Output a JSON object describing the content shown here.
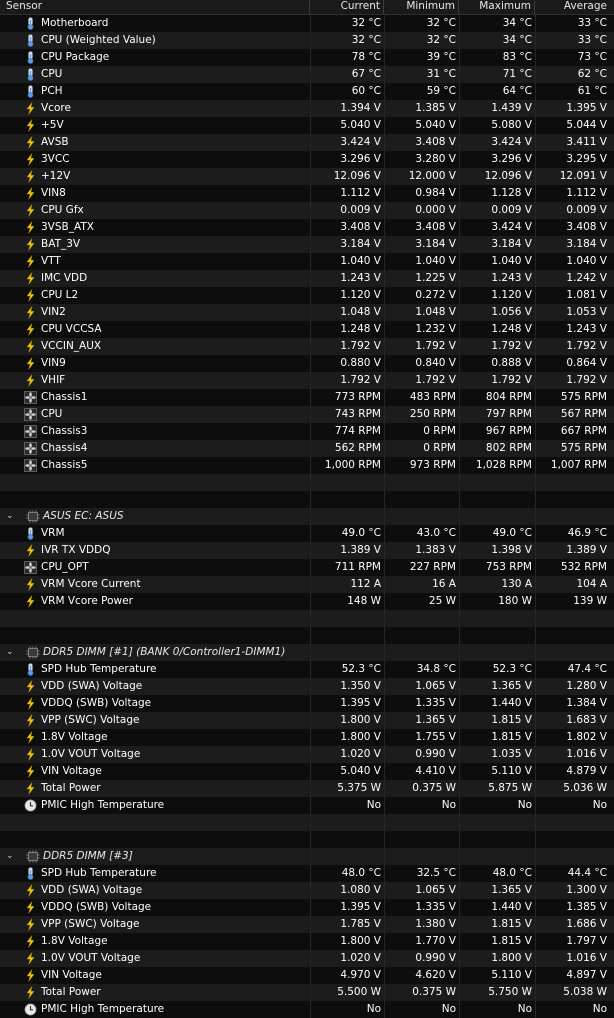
{
  "header": {
    "sensor": "Sensor",
    "current": "Current",
    "minimum": "Minimum",
    "maximum": "Maximum",
    "average": "Average"
  },
  "sections": [
    {
      "title": "",
      "rows": [
        {
          "icon": "thermometer-icon",
          "name": "Motherboard",
          "cur": "32 °C",
          "min": "32 °C",
          "max": "34 °C",
          "avg": "33 °C"
        },
        {
          "icon": "thermometer-icon",
          "name": "CPU (Weighted Value)",
          "cur": "32 °C",
          "min": "32 °C",
          "max": "34 °C",
          "avg": "33 °C"
        },
        {
          "icon": "thermometer-icon",
          "name": "CPU Package",
          "cur": "78 °C",
          "min": "39 °C",
          "max": "83 °C",
          "avg": "73 °C"
        },
        {
          "icon": "thermometer-icon",
          "name": "CPU",
          "cur": "67 °C",
          "min": "31 °C",
          "max": "71 °C",
          "avg": "62 °C"
        },
        {
          "icon": "thermometer-icon",
          "name": "PCH",
          "cur": "60 °C",
          "min": "59 °C",
          "max": "64 °C",
          "avg": "61 °C"
        },
        {
          "icon": "lightning-icon",
          "name": "Vcore",
          "cur": "1.394 V",
          "min": "1.385 V",
          "max": "1.439 V",
          "avg": "1.395 V"
        },
        {
          "icon": "lightning-icon",
          "name": "+5V",
          "cur": "5.040 V",
          "min": "5.040 V",
          "max": "5.080 V",
          "avg": "5.044 V"
        },
        {
          "icon": "lightning-icon",
          "name": "AVSB",
          "cur": "3.424 V",
          "min": "3.408 V",
          "max": "3.424 V",
          "avg": "3.411 V"
        },
        {
          "icon": "lightning-icon",
          "name": "3VCC",
          "cur": "3.296 V",
          "min": "3.280 V",
          "max": "3.296 V",
          "avg": "3.295 V"
        },
        {
          "icon": "lightning-icon",
          "name": "+12V",
          "cur": "12.096 V",
          "min": "12.000 V",
          "max": "12.096 V",
          "avg": "12.091 V"
        },
        {
          "icon": "lightning-icon",
          "name": "VIN8",
          "cur": "1.112 V",
          "min": "0.984 V",
          "max": "1.128 V",
          "avg": "1.112 V"
        },
        {
          "icon": "lightning-icon",
          "name": "CPU Gfx",
          "cur": "0.009 V",
          "min": "0.000 V",
          "max": "0.009 V",
          "avg": "0.009 V"
        },
        {
          "icon": "lightning-icon",
          "name": "3VSB_ATX",
          "cur": "3.408 V",
          "min": "3.408 V",
          "max": "3.424 V",
          "avg": "3.408 V"
        },
        {
          "icon": "lightning-icon",
          "name": "BAT_3V",
          "cur": "3.184 V",
          "min": "3.184 V",
          "max": "3.184 V",
          "avg": "3.184 V"
        },
        {
          "icon": "lightning-icon",
          "name": "VTT",
          "cur": "1.040 V",
          "min": "1.040 V",
          "max": "1.040 V",
          "avg": "1.040 V"
        },
        {
          "icon": "lightning-icon",
          "name": "IMC VDD",
          "cur": "1.243 V",
          "min": "1.225 V",
          "max": "1.243 V",
          "avg": "1.242 V"
        },
        {
          "icon": "lightning-icon",
          "name": "CPU L2",
          "cur": "1.120 V",
          "min": "0.272 V",
          "max": "1.120 V",
          "avg": "1.081 V"
        },
        {
          "icon": "lightning-icon",
          "name": "VIN2",
          "cur": "1.048 V",
          "min": "1.048 V",
          "max": "1.056 V",
          "avg": "1.053 V"
        },
        {
          "icon": "lightning-icon",
          "name": "CPU VCCSA",
          "cur": "1.248 V",
          "min": "1.232 V",
          "max": "1.248 V",
          "avg": "1.243 V"
        },
        {
          "icon": "lightning-icon",
          "name": "VCCIN_AUX",
          "cur": "1.792 V",
          "min": "1.792 V",
          "max": "1.792 V",
          "avg": "1.792 V"
        },
        {
          "icon": "lightning-icon",
          "name": "VIN9",
          "cur": "0.880 V",
          "min": "0.840 V",
          "max": "0.888 V",
          "avg": "0.864 V"
        },
        {
          "icon": "lightning-icon",
          "name": "VHIF",
          "cur": "1.792 V",
          "min": "1.792 V",
          "max": "1.792 V",
          "avg": "1.792 V"
        },
        {
          "icon": "fan-icon",
          "name": "Chassis1",
          "cur": "773 RPM",
          "min": "483 RPM",
          "max": "804 RPM",
          "avg": "575 RPM"
        },
        {
          "icon": "fan-icon",
          "name": "CPU",
          "cur": "743 RPM",
          "min": "250 RPM",
          "max": "797 RPM",
          "avg": "567 RPM"
        },
        {
          "icon": "fan-icon",
          "name": "Chassis3",
          "cur": "774 RPM",
          "min": "0 RPM",
          "max": "967 RPM",
          "avg": "667 RPM"
        },
        {
          "icon": "fan-icon",
          "name": "Chassis4",
          "cur": "562 RPM",
          "min": "0 RPM",
          "max": "802 RPM",
          "avg": "575 RPM"
        },
        {
          "icon": "fan-icon",
          "name": "Chassis5",
          "cur": "1,000 RPM",
          "min": "973 RPM",
          "max": "1,028 RPM",
          "avg": "1,007 RPM"
        }
      ]
    },
    {
      "title": "ASUS EC: ASUS",
      "rows": [
        {
          "icon": "thermometer-icon",
          "name": "VRM",
          "cur": "49.0 °C",
          "min": "43.0 °C",
          "max": "49.0 °C",
          "avg": "46.9 °C"
        },
        {
          "icon": "lightning-icon",
          "name": "IVR TX VDDQ",
          "cur": "1.389 V",
          "min": "1.383 V",
          "max": "1.398 V",
          "avg": "1.389 V"
        },
        {
          "icon": "fan-icon",
          "name": "CPU_OPT",
          "cur": "711 RPM",
          "min": "227 RPM",
          "max": "753 RPM",
          "avg": "532 RPM"
        },
        {
          "icon": "lightning-icon",
          "name": "VRM Vcore Current",
          "cur": "112 A",
          "min": "16 A",
          "max": "130 A",
          "avg": "104 A"
        },
        {
          "icon": "lightning-icon",
          "name": "VRM Vcore Power",
          "cur": "148 W",
          "min": "25 W",
          "max": "180 W",
          "avg": "139 W"
        }
      ]
    },
    {
      "title": "DDR5 DIMM [#1] (BANK 0/Controller1-DIMM1)",
      "rows": [
        {
          "icon": "thermometer-icon",
          "name": "SPD Hub Temperature",
          "cur": "52.3 °C",
          "min": "34.8 °C",
          "max": "52.3 °C",
          "avg": "47.4 °C"
        },
        {
          "icon": "lightning-icon",
          "name": "VDD (SWA) Voltage",
          "cur": "1.350 V",
          "min": "1.065 V",
          "max": "1.365 V",
          "avg": "1.280 V"
        },
        {
          "icon": "lightning-icon",
          "name": "VDDQ (SWB) Voltage",
          "cur": "1.395 V",
          "min": "1.335 V",
          "max": "1.440 V",
          "avg": "1.384 V"
        },
        {
          "icon": "lightning-icon",
          "name": "VPP (SWC) Voltage",
          "cur": "1.800 V",
          "min": "1.365 V",
          "max": "1.815 V",
          "avg": "1.683 V"
        },
        {
          "icon": "lightning-icon",
          "name": "1.8V Voltage",
          "cur": "1.800 V",
          "min": "1.755 V",
          "max": "1.815 V",
          "avg": "1.802 V"
        },
        {
          "icon": "lightning-icon",
          "name": "1.0V VOUT Voltage",
          "cur": "1.020 V",
          "min": "0.990 V",
          "max": "1.035 V",
          "avg": "1.016 V"
        },
        {
          "icon": "lightning-icon",
          "name": "VIN Voltage",
          "cur": "5.040 V",
          "min": "4.410 V",
          "max": "5.110 V",
          "avg": "4.879 V"
        },
        {
          "icon": "lightning-icon",
          "name": "Total Power",
          "cur": "5.375 W",
          "min": "0.375 W",
          "max": "5.875 W",
          "avg": "5.036 W"
        },
        {
          "icon": "clock-icon",
          "name": "PMIC High Temperature",
          "cur": "No",
          "min": "No",
          "max": "No",
          "avg": "No"
        }
      ]
    },
    {
      "title": "DDR5 DIMM [#3]",
      "rows": [
        {
          "icon": "thermometer-icon",
          "name": "SPD Hub Temperature",
          "cur": "48.0 °C",
          "min": "32.5 °C",
          "max": "48.0 °C",
          "avg": "44.4 °C"
        },
        {
          "icon": "lightning-icon",
          "name": "VDD (SWA) Voltage",
          "cur": "1.080 V",
          "min": "1.065 V",
          "max": "1.365 V",
          "avg": "1.300 V"
        },
        {
          "icon": "lightning-icon",
          "name": "VDDQ (SWB) Voltage",
          "cur": "1.395 V",
          "min": "1.335 V",
          "max": "1.440 V",
          "avg": "1.385 V"
        },
        {
          "icon": "lightning-icon",
          "name": "VPP (SWC) Voltage",
          "cur": "1.785 V",
          "min": "1.380 V",
          "max": "1.815 V",
          "avg": "1.686 V"
        },
        {
          "icon": "lightning-icon",
          "name": "1.8V Voltage",
          "cur": "1.800 V",
          "min": "1.770 V",
          "max": "1.815 V",
          "avg": "1.797 V"
        },
        {
          "icon": "lightning-icon",
          "name": "1.0V VOUT Voltage",
          "cur": "1.020 V",
          "min": "0.990 V",
          "max": "1.800 V",
          "avg": "1.016 V"
        },
        {
          "icon": "lightning-icon",
          "name": "VIN Voltage",
          "cur": "4.970 V",
          "min": "4.620 V",
          "max": "5.110 V",
          "avg": "4.897 V"
        },
        {
          "icon": "lightning-icon",
          "name": "Total Power",
          "cur": "5.500 W",
          "min": "0.375 W",
          "max": "5.750 W",
          "avg": "5.038 W"
        },
        {
          "icon": "clock-icon",
          "name": "PMIC High Temperature",
          "cur": "No",
          "min": "No",
          "max": "No",
          "avg": "No"
        }
      ]
    }
  ]
}
